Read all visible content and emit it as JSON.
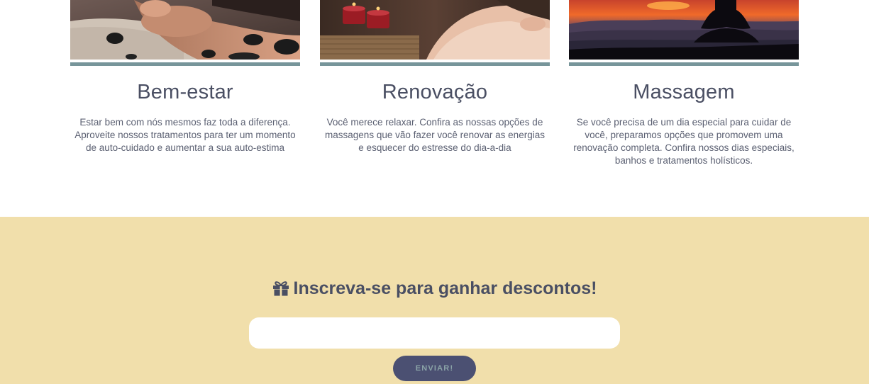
{
  "cards": [
    {
      "image_icon": "massage-stones-photo",
      "title": "Bem-estar",
      "text": "Estar bem com nós mesmos faz toda a diferença. Aproveite nossos tratamentos para ter um momento de auto-cuidado e aumentar a sua auto-estima"
    },
    {
      "image_icon": "candles-relax-photo",
      "title": "Renovação",
      "text": "Você merece relaxar. Confira as nossas opções de massagens que vão fazer você renovar as energias e esquecer do estresse do dia-a-dia"
    },
    {
      "image_icon": "sunset-meditation-photo",
      "title": "Massagem",
      "text": "Se você precisa de um dia especial para cuidar de você, preparamos opções que promovem uma renovação completa. Confira nossos dias especiais, banhos e tratamentos holísticos."
    }
  ],
  "newsletter": {
    "icon": "gift-icon",
    "title": "Inscreva-se para ganhar descontos!",
    "input_value": "",
    "button_label": "ENVIAR!"
  },
  "colors": {
    "accent_bar": "#77959a",
    "newsletter_bg": "#f1dfab",
    "button_bg": "#4b5072",
    "button_text": "#8aa3a7",
    "text": "#4a4f63"
  }
}
